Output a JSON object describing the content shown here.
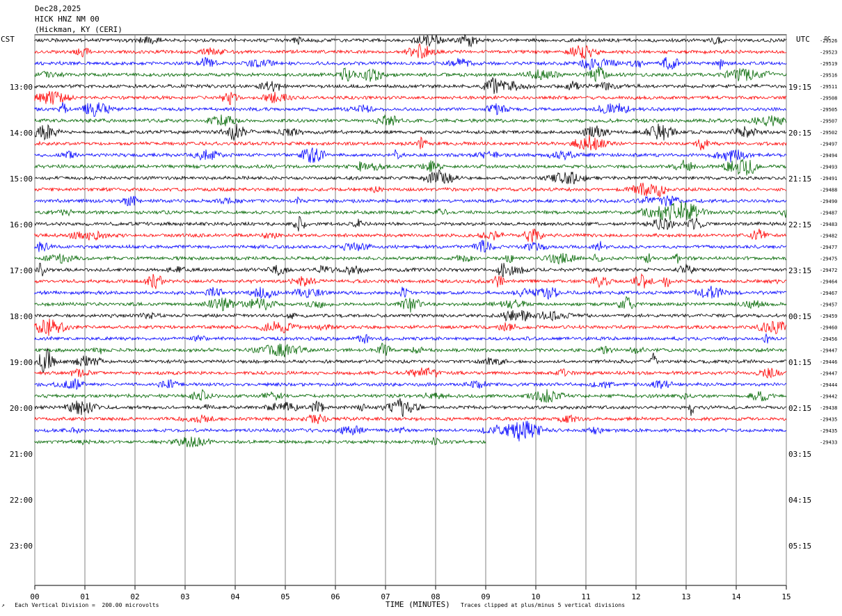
{
  "header": {
    "date": "Dec28,2025",
    "station": "HICK HNZ NM 00",
    "location": "(Hickman, KY (CERI)"
  },
  "left_corner_label": "CST",
  "right_corner_label": "UTC",
  "dc_label": "DC",
  "footer": {
    "left": "Each Vertical Division =  200.00 microvolts",
    "right": "Traces clipped at plus/minus 5 vertical divisions",
    "corner_mark": "↗"
  },
  "colors": {
    "black": "#000000",
    "red": "#ff0000",
    "blue": "#0000ff",
    "green": "#006600",
    "grid": "#808080"
  },
  "chart_data": {
    "type": "line",
    "title": "HICK HNZ NM 00",
    "xlabel": "TIME (MINUTES)",
    "ylabel": "",
    "xlim": [
      0,
      15
    ],
    "x_ticks": [
      "00",
      "01",
      "02",
      "03",
      "04",
      "05",
      "06",
      "07",
      "08",
      "09",
      "10",
      "11",
      "12",
      "13",
      "14",
      "15"
    ],
    "left_hour_labels": [
      "13:00",
      "14:00",
      "15:00",
      "16:00",
      "17:00",
      "18:00",
      "19:00",
      "20:00",
      "21:00",
      "22:00",
      "23:00"
    ],
    "right_hour_labels": [
      "19:15",
      "20:15",
      "21:15",
      "22:15",
      "23:15",
      "00:15",
      "01:15",
      "02:15",
      "03:15",
      "04:15",
      "05:15"
    ],
    "trace_color_cycle": [
      "black",
      "red",
      "blue",
      "green"
    ],
    "trace_dc_offsets": [
      29526,
      29523,
      29519,
      29516,
      29511,
      29508,
      29505,
      29507,
      29502,
      29497,
      29494,
      29493,
      29491,
      29488,
      29490,
      29487,
      29483,
      29482,
      29477,
      29475,
      29472,
      29464,
      29467,
      29457,
      29459,
      29460,
      29456,
      29447,
      29446,
      29447,
      29444,
      29442,
      29438,
      29435,
      29435,
      29433
    ],
    "last_trace_end_minute": 9.0,
    "grid": true
  }
}
